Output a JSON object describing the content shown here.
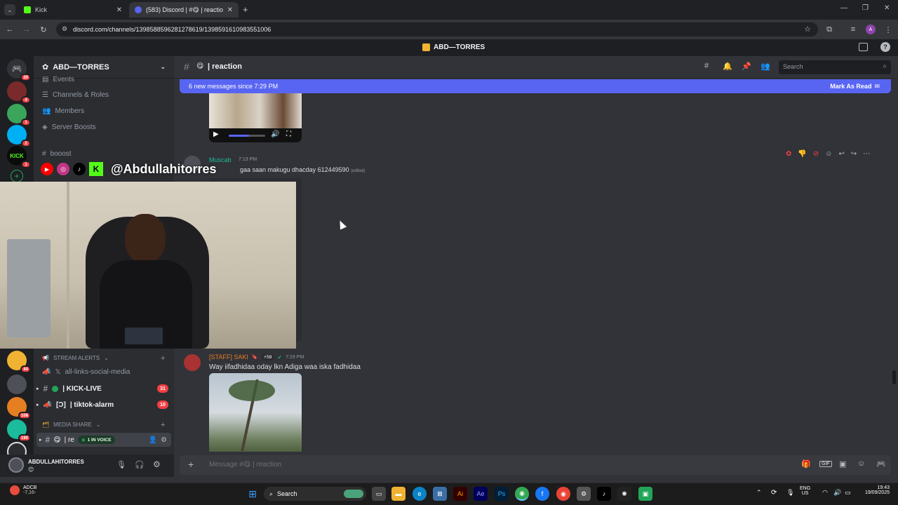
{
  "browser": {
    "tabs": [
      {
        "title": "Kick",
        "active": false
      },
      {
        "title": "(583) Discord | #😋 | reaction |",
        "active": true
      }
    ],
    "url": "discord.com/channels/1398588596281278619/1398591610983551006"
  },
  "discord": {
    "server_title_bar": "ABD—TORRES",
    "server_name": "ABD—TORRES",
    "server_badges": [
      "20",
      "4",
      "1",
      "2",
      "1",
      "44",
      "108",
      "190"
    ],
    "sidebar_top": [
      "Events",
      "Channels & Roles",
      "Members",
      "Server Boosts"
    ],
    "boost_channel": "booost",
    "categories": [
      {
        "name": "STREAM ALERTS",
        "channels": [
          {
            "name": "all-links-social-media",
            "badge": ""
          },
          {
            "name": "| KICK-LIVE",
            "badge": "31"
          },
          {
            "name": "| tiktok-alarm",
            "prefix": "[Ɔ]",
            "badge": "10"
          }
        ]
      },
      {
        "name": "MEDIA SHARE",
        "channels": [
          {
            "name": "| re",
            "badge": ""
          }
        ]
      }
    ],
    "voice_pill": "1 IN VOICE",
    "user": {
      "name": "ABDULLAHITORRES",
      "status": "😊"
    },
    "channel_header": {
      "name": "| reaction",
      "search_placeholder": "Search"
    },
    "new_messages_bar": {
      "text": "6 new messages since 7:29 PM",
      "action": "Mark As Read"
    },
    "messages": [
      {
        "author": "Muscab",
        "time": "7:13 PM",
        "text": "gaa saan makugu dhacday 612449590",
        "edited": "(edited)"
      },
      {
        "author": "[STAFF] SAKI",
        "tag": "59",
        "time": "7:19 PM",
        "text": "Way iifadhidaa oday lkn Adiga waa iska fadhidaa"
      }
    ],
    "composer_placeholder": "Message #😋 | reaction"
  },
  "overlay": {
    "handle": "@Abdullahitorres"
  },
  "taskbar": {
    "weather": {
      "label": "ADCB",
      "value": "-7,16-"
    },
    "search": "Search",
    "lang": "ENG",
    "region": "US",
    "time": "19:43",
    "date": "19/09/2025"
  },
  "colors": {
    "blurple": "#5865f2",
    "red": "#f23f43",
    "green": "#23a559"
  }
}
